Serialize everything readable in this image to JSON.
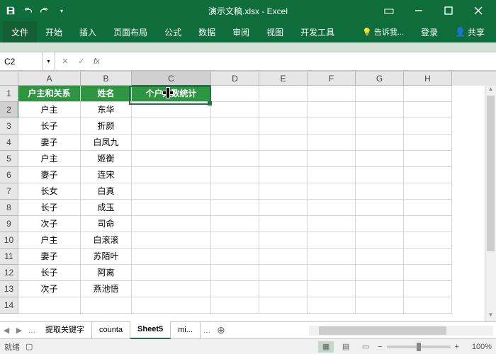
{
  "title": "演示文稿.xlsx - Excel",
  "ribbon": {
    "file": "文件",
    "tabs": [
      "开始",
      "插入",
      "页面布局",
      "公式",
      "数据",
      "审阅",
      "视图",
      "开发工具"
    ],
    "tell": "告诉我...",
    "login": "登录",
    "share": "共享"
  },
  "namebox": "C2",
  "fx": "fx",
  "headers": {
    "A": "户主和关系",
    "B": "姓名",
    "C": "个户人数统计"
  },
  "rows": [
    {
      "A": "户主",
      "B": "东华"
    },
    {
      "A": "长子",
      "B": "折颜"
    },
    {
      "A": "妻子",
      "B": "白凤九"
    },
    {
      "A": "户主",
      "B": "姬衡"
    },
    {
      "A": "妻子",
      "B": "连宋"
    },
    {
      "A": "长女",
      "B": "白真"
    },
    {
      "A": "长子",
      "B": "成玉"
    },
    {
      "A": "次子",
      "B": "司命"
    },
    {
      "A": "户主",
      "B": "白滚滚"
    },
    {
      "A": "妻子",
      "B": "苏陌叶"
    },
    {
      "A": "长子",
      "B": "阿离"
    },
    {
      "A": "次子",
      "B": "燕池悟"
    }
  ],
  "cols": [
    "A",
    "B",
    "C",
    "D",
    "E",
    "F",
    "G",
    "H"
  ],
  "sheets": {
    "t1": "提取关键字",
    "t2": "counta",
    "t3": "Sheet5",
    "t4": "mi..."
  },
  "status": {
    "ready": "就绪",
    "zoom": "100%"
  }
}
